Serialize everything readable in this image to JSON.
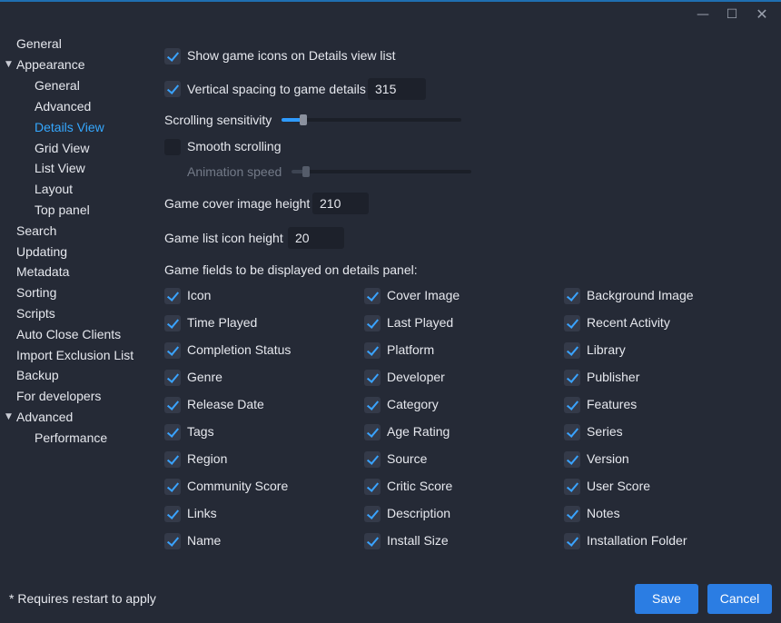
{
  "window": {
    "minimize_icon": "minimize-icon",
    "maximize_icon": "maximize-icon",
    "close_icon": "close-icon",
    "accent": "#1f6fb2"
  },
  "sidebar": {
    "items": [
      {
        "label": "General"
      },
      {
        "label": "Appearance",
        "expanded": true
      },
      {
        "label": "General"
      },
      {
        "label": "Advanced"
      },
      {
        "label": "Details View",
        "active": true
      },
      {
        "label": "Grid View"
      },
      {
        "label": "List View"
      },
      {
        "label": "Layout"
      },
      {
        "label": "Top panel"
      },
      {
        "label": "Search"
      },
      {
        "label": "Updating"
      },
      {
        "label": "Metadata"
      },
      {
        "label": "Sorting"
      },
      {
        "label": "Scripts"
      },
      {
        "label": "Auto Close Clients"
      },
      {
        "label": "Import Exclusion List"
      },
      {
        "label": "Backup"
      },
      {
        "label": "For developers"
      },
      {
        "label": "Advanced",
        "expanded": true
      },
      {
        "label": "Performance"
      }
    ],
    "active_color": "#35a8ff"
  },
  "settings": {
    "show_icons": {
      "label": "Show game icons on Details view list",
      "checked": true
    },
    "vertical_spacing": {
      "label": "Vertical spacing to game details",
      "checked": true,
      "value": "315"
    },
    "scrolling_sensitivity": {
      "label": "Scrolling sensitivity",
      "level": 0.12
    },
    "smooth_scrolling": {
      "label": "Smooth scrolling",
      "checked": false
    },
    "animation_speed": {
      "label": "Animation speed",
      "level": 0.08,
      "enabled": false
    },
    "cover_height": {
      "label": "Game cover image height",
      "value": "210"
    },
    "icon_height": {
      "label": "Game list icon height",
      "value": "20"
    },
    "fields_heading": "Game fields to be displayed on details panel:"
  },
  "fields": [
    [
      "Icon",
      "Cover Image",
      "Background Image"
    ],
    [
      "Time Played",
      "Last Played",
      "Recent Activity"
    ],
    [
      "Completion Status",
      "Platform",
      "Library"
    ],
    [
      "Genre",
      "Developer",
      "Publisher"
    ],
    [
      "Release Date",
      "Category",
      "Features"
    ],
    [
      "Tags",
      "Age Rating",
      "Series"
    ],
    [
      "Region",
      "Source",
      "Version"
    ],
    [
      "Community Score",
      "Critic Score",
      "User Score"
    ],
    [
      "Links",
      "Description",
      "Notes"
    ],
    [
      "Name",
      "Install Size",
      "Installation Folder"
    ]
  ],
  "footer": {
    "note": "* Requires restart to apply",
    "save_label": "Save",
    "cancel_label": "Cancel"
  }
}
